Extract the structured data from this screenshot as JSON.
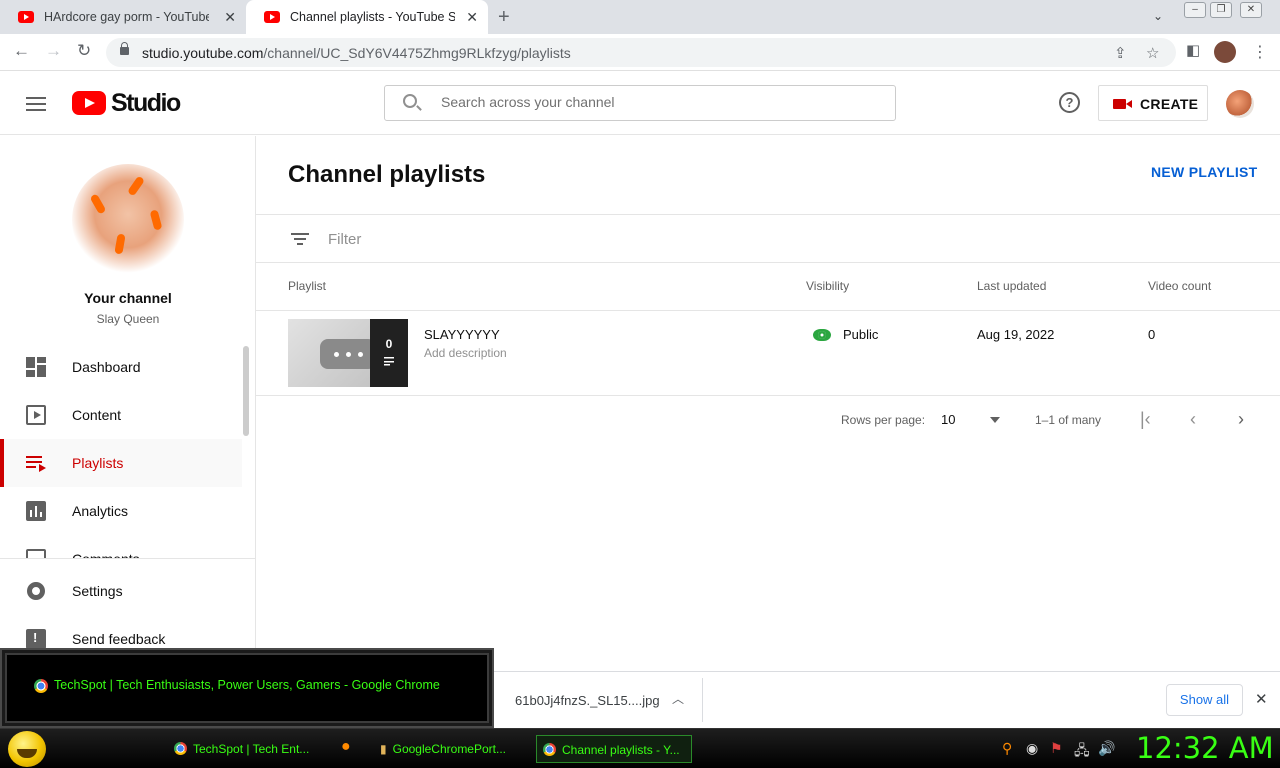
{
  "browser": {
    "tabs": [
      {
        "title": "HArdcore gay porm - YouTube",
        "active": false
      },
      {
        "title": "Channel playlists - YouTube Studio",
        "active": true
      }
    ],
    "url_host": "studio.youtube.com",
    "url_path": "/channel/UC_SdY6V4475Zhmg9RLkfzyg/playlists"
  },
  "header": {
    "logo_text": "Studio",
    "search_placeholder": "Search across your channel",
    "help_glyph": "?",
    "create_label": "CREATE"
  },
  "sidebar": {
    "your_channel": "Your channel",
    "channel_name": "Slay Queen",
    "items": [
      {
        "label": "Dashboard",
        "icon": "dashboard-icon"
      },
      {
        "label": "Content",
        "icon": "content-icon"
      },
      {
        "label": "Playlists",
        "icon": "playlists-icon",
        "active": true
      },
      {
        "label": "Analytics",
        "icon": "analytics-icon"
      },
      {
        "label": "Comments",
        "icon": "comments-icon"
      }
    ],
    "bottom_items": [
      {
        "label": "Settings",
        "icon": "gear-icon"
      },
      {
        "label": "Send feedback",
        "icon": "feedback-icon"
      }
    ]
  },
  "main": {
    "title": "Channel playlists",
    "new_playlist": "NEW PLAYLIST",
    "filter_placeholder": "Filter",
    "columns": [
      "Playlist",
      "Visibility",
      "Last updated",
      "Video count"
    ],
    "rows": [
      {
        "title": "SLAYYYYYY",
        "description": "Add description",
        "thumb_count": "0",
        "visibility": "Public",
        "last_updated": "Aug 19, 2022",
        "video_count": "0"
      }
    ],
    "pagination": {
      "rows_per_page_label": "Rows per page:",
      "rows_per_page": "10",
      "range": "1–1 of many"
    }
  },
  "download_bar": {
    "file": "61b0Jj4fnzS._SL15....jpg",
    "show_all": "Show all"
  },
  "popup": {
    "text": "TechSpot | Tech Enthusiasts, Power Users, Gamers - Google Chrome"
  },
  "taskbar": {
    "items": [
      "TechSpot | Tech Ent...",
      "GoogleChromePort...",
      "Channel playlists - Y..."
    ],
    "clock": "12:32 AM"
  },
  "colors": {
    "brand_red": "#ff0000",
    "active_red": "#cc0000",
    "link_blue": "#065fd4",
    "public_green": "#2ba640",
    "taskbar_green": "#39ff14"
  }
}
